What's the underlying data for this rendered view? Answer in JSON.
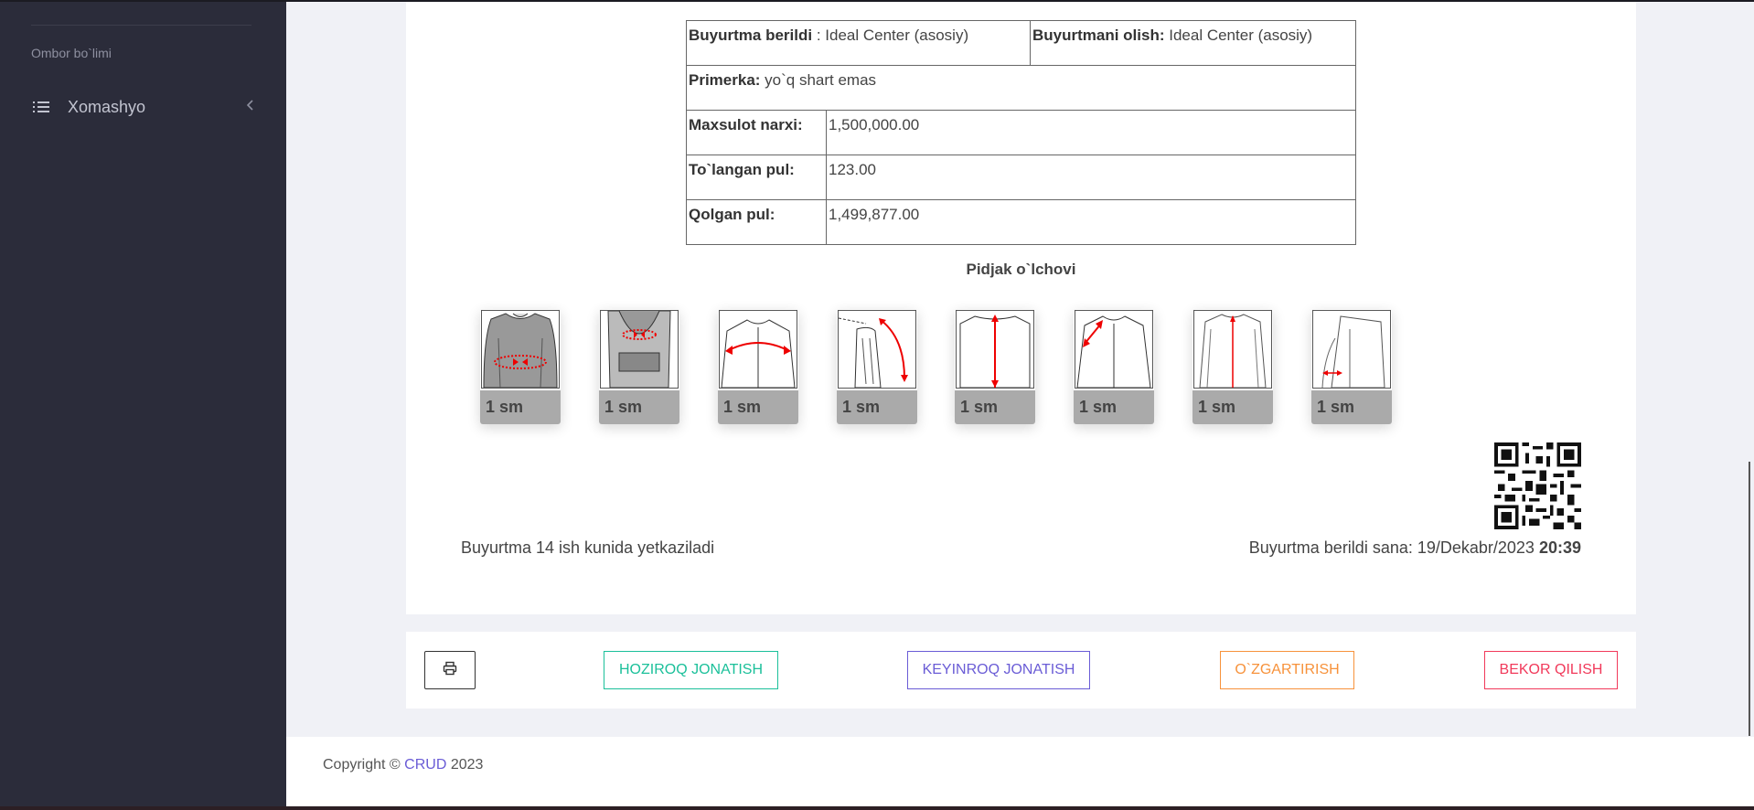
{
  "sidebar": {
    "section_label": "Ombor bo`limi",
    "items": [
      {
        "label": "Xomashyo",
        "icon": "list-icon",
        "chevron": "chevron-left-icon"
      }
    ]
  },
  "order": {
    "given_label": "Buyurtma berildi",
    "given_value": " : Ideal Center (asosiy)",
    "receive_label": "Buyurtmani olish:",
    "receive_value": " Ideal Center (asosiy)",
    "primerka_label": "Primerka:",
    "primerka_value": " yo`q shart emas",
    "price_label": "Maxsulot narxi:",
    "price_value": "1,500,000.00",
    "paid_label": "To`langan pul:",
    "paid_value": "123.00",
    "remaining_label": "Qolgan pul:",
    "remaining_value": "1,499,877.00"
  },
  "measurements": {
    "title": "Pidjak o`lchovi",
    "items": [
      {
        "value": "1 sm"
      },
      {
        "value": "1 sm"
      },
      {
        "value": "1 sm"
      },
      {
        "value": "1 sm"
      },
      {
        "value": "1 sm"
      },
      {
        "value": "1 sm"
      },
      {
        "value": "1 sm"
      },
      {
        "value": "1 sm"
      }
    ]
  },
  "delivery_text": "Buyurtma 14 ish kunida yetkaziladi",
  "date": {
    "label": "Buyurtma berildi sana: 19/Dekabr/2023 ",
    "time": "20:39"
  },
  "actions": {
    "print_icon": "printer-icon",
    "now": "HOZIROQ JONATISH",
    "later": "KEYINROQ JONATISH",
    "edit": "O`ZGARTIRISH",
    "cancel": "BEKOR QILISH"
  },
  "footer": {
    "prefix": "Copyright © ",
    "link": "CRUD",
    "suffix": " 2023"
  },
  "colors": {
    "sidebar_bg": "#2b2c3a",
    "success": "#1bc09a",
    "primary": "#6a5cd6",
    "warning": "#f7923b",
    "danger": "#f1395a"
  }
}
